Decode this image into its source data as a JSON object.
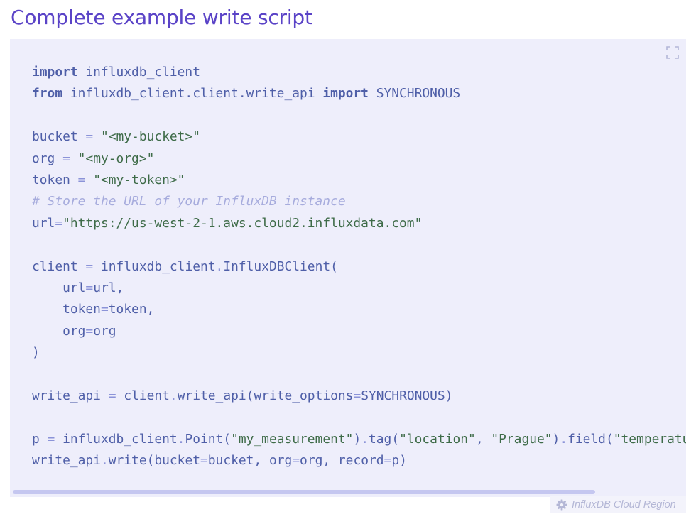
{
  "page": {
    "title": "Complete example write script"
  },
  "code_block": {
    "language": "python",
    "fullscreen_icon": "expand-icon",
    "lines": [
      [
        {
          "t": "import",
          "c": "kw"
        },
        {
          "t": " influxdb_client",
          "c": "pl"
        }
      ],
      [
        {
          "t": "from",
          "c": "kw"
        },
        {
          "t": " influxdb_client.client.write_api ",
          "c": "pl"
        },
        {
          "t": "import",
          "c": "kw"
        },
        {
          "t": " SYNCHRONOUS",
          "c": "pl"
        }
      ],
      [],
      [
        {
          "t": "bucket ",
          "c": "pl"
        },
        {
          "t": "=",
          "c": "op"
        },
        {
          "t": " ",
          "c": "pl"
        },
        {
          "t": "\"<my-bucket>\"",
          "c": "str"
        }
      ],
      [
        {
          "t": "org ",
          "c": "pl"
        },
        {
          "t": "=",
          "c": "op"
        },
        {
          "t": " ",
          "c": "pl"
        },
        {
          "t": "\"<my-org>\"",
          "c": "str"
        }
      ],
      [
        {
          "t": "token ",
          "c": "pl"
        },
        {
          "t": "=",
          "c": "op"
        },
        {
          "t": " ",
          "c": "pl"
        },
        {
          "t": "\"<my-token>\"",
          "c": "str"
        }
      ],
      [
        {
          "t": "# Store the URL of your InfluxDB instance",
          "c": "cm"
        }
      ],
      [
        {
          "t": "url",
          "c": "pl"
        },
        {
          "t": "=",
          "c": "op"
        },
        {
          "t": "\"https://us-west-2-1.aws.cloud2.influxdata.com\"",
          "c": "str"
        }
      ],
      [],
      [
        {
          "t": "client ",
          "c": "pl"
        },
        {
          "t": "=",
          "c": "op"
        },
        {
          "t": " influxdb_client",
          "c": "pl"
        },
        {
          "t": ".",
          "c": "op"
        },
        {
          "t": "InfluxDBClient(",
          "c": "pl"
        }
      ],
      [
        {
          "t": "    url",
          "c": "pl"
        },
        {
          "t": "=",
          "c": "op"
        },
        {
          "t": "url,",
          "c": "pl"
        }
      ],
      [
        {
          "t": "    token",
          "c": "pl"
        },
        {
          "t": "=",
          "c": "op"
        },
        {
          "t": "token,",
          "c": "pl"
        }
      ],
      [
        {
          "t": "    org",
          "c": "pl"
        },
        {
          "t": "=",
          "c": "op"
        },
        {
          "t": "org",
          "c": "pl"
        }
      ],
      [
        {
          "t": ")",
          "c": "pl"
        }
      ],
      [],
      [
        {
          "t": "write_api ",
          "c": "pl"
        },
        {
          "t": "=",
          "c": "op"
        },
        {
          "t": " client",
          "c": "pl"
        },
        {
          "t": ".",
          "c": "op"
        },
        {
          "t": "write_api(write_options",
          "c": "pl"
        },
        {
          "t": "=",
          "c": "op"
        },
        {
          "t": "SYNCHRONOUS)",
          "c": "pl"
        }
      ],
      [],
      [
        {
          "t": "p ",
          "c": "pl"
        },
        {
          "t": "=",
          "c": "op"
        },
        {
          "t": " influxdb_client",
          "c": "pl"
        },
        {
          "t": ".",
          "c": "op"
        },
        {
          "t": "Point(",
          "c": "pl"
        },
        {
          "t": "\"my_measurement\"",
          "c": "str"
        },
        {
          "t": ")",
          "c": "pl"
        },
        {
          "t": ".",
          "c": "op"
        },
        {
          "t": "tag(",
          "c": "pl"
        },
        {
          "t": "\"location\"",
          "c": "str"
        },
        {
          "t": ", ",
          "c": "pl"
        },
        {
          "t": "\"Prague\"",
          "c": "str"
        },
        {
          "t": ")",
          "c": "pl"
        },
        {
          "t": ".",
          "c": "op"
        },
        {
          "t": "field(",
          "c": "pl"
        },
        {
          "t": "\"temperatu",
          "c": "str"
        }
      ],
      [
        {
          "t": "write_api",
          "c": "pl"
        },
        {
          "t": ".",
          "c": "op"
        },
        {
          "t": "write(bucket",
          "c": "pl"
        },
        {
          "t": "=",
          "c": "op"
        },
        {
          "t": "bucket, org",
          "c": "pl"
        },
        {
          "t": "=",
          "c": "op"
        },
        {
          "t": "org, record",
          "c": "pl"
        },
        {
          "t": "=",
          "c": "op"
        },
        {
          "t": "p)",
          "c": "pl"
        }
      ]
    ]
  },
  "region_selector": {
    "icon": "gear-icon",
    "label": "InfluxDB Cloud Region"
  },
  "colors": {
    "title": "#5a43c7",
    "code_background": "#eeeefb",
    "keyword": "#4f5fa8",
    "string": "#3e6b48",
    "comment": "#a7acdd",
    "operator": "#8b93d8",
    "scrollbar": "#c5c7f0"
  }
}
